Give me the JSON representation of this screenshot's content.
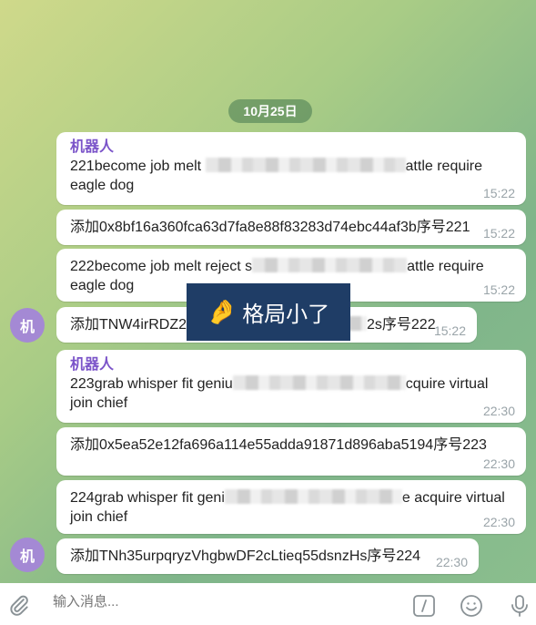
{
  "date_chip": "10月25日",
  "messages": [
    {
      "sender": "机器人",
      "text_before": "221become job melt ",
      "text_after": "attle require eagle dog",
      "time": "15:22"
    },
    {
      "text": "添加0x8bf16a360fca63d7fa8e88f83283d74ebc44af3b序号221",
      "time": "15:22"
    },
    {
      "text_before": "222become job melt reject s",
      "text_after": "attle require eagle dog",
      "time": "15:22"
    },
    {
      "text_before": "添加TNW4irRDZ2c",
      "text_after": "2s序号222",
      "time": "15:22",
      "avatar": "机"
    },
    {
      "sender": "机器人",
      "text_before": "223grab whisper fit geniu",
      "text_after": "cquire virtual join chief",
      "time": "22:30"
    },
    {
      "text": "添加0x5ea52e12fa696a114e55adda91871d896aba5194序号223",
      "time": "22:30"
    },
    {
      "text_before": "224grab whisper fit geni",
      "text_after": "e acquire virtual join chief",
      "time": "22:30"
    },
    {
      "text": "添加TNh35urpqryzVhgbwDF2cLtieq55dsnzHs序号224",
      "time": "22:30",
      "avatar": "机"
    }
  ],
  "sticker": {
    "emoji": "🤌",
    "text": "格局小了"
  },
  "composer": {
    "placeholder": "输入消息..."
  },
  "icons": [
    "paperclip-icon",
    "command-icon",
    "emoji-icon",
    "microphone-icon"
  ]
}
